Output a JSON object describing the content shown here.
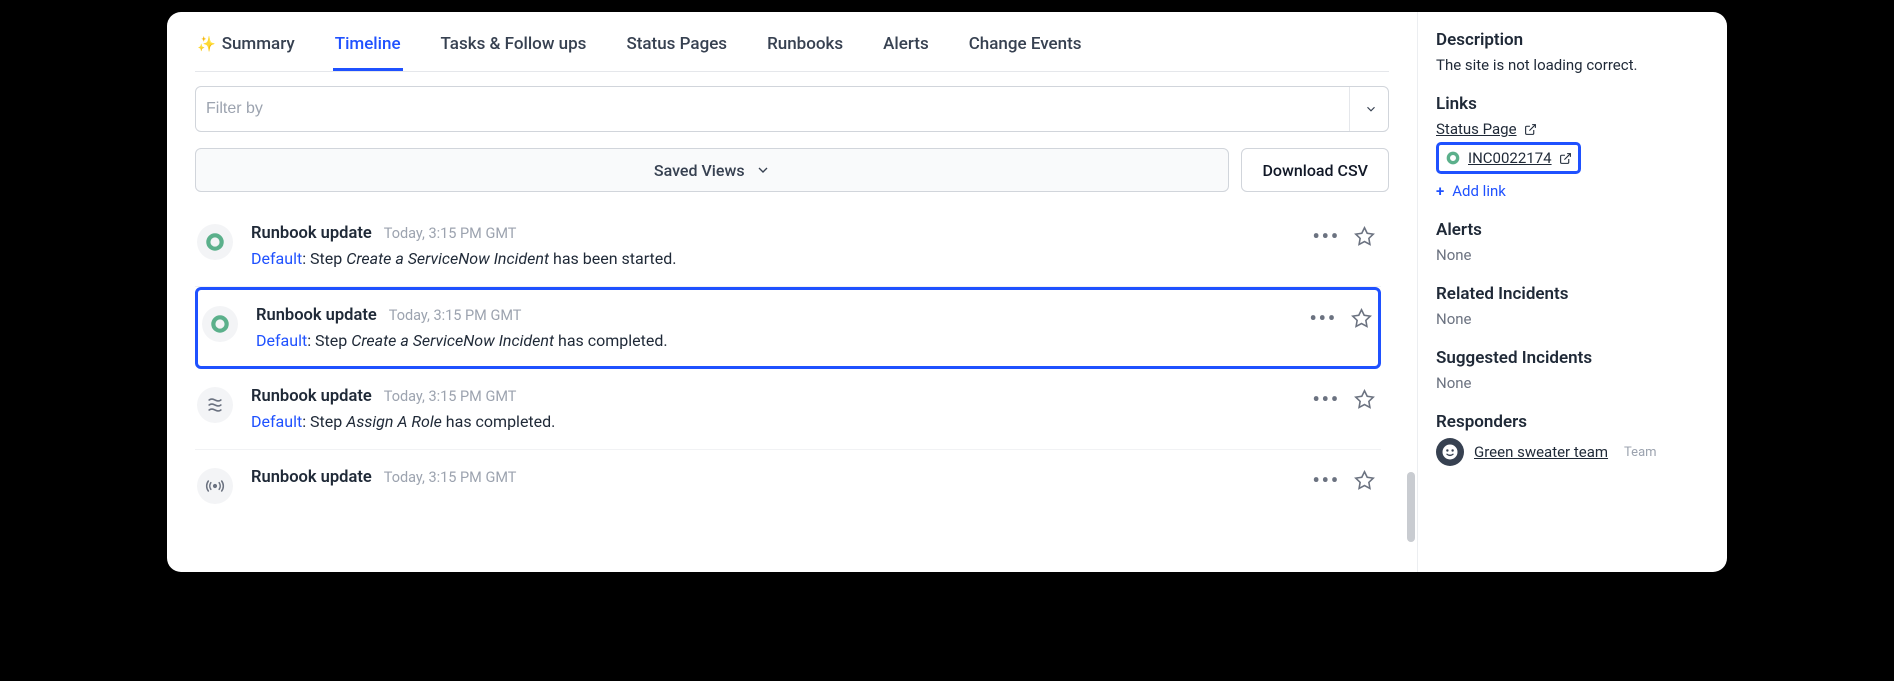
{
  "tabs": {
    "summary": "Summary",
    "timeline": "Timeline",
    "tasks": "Tasks & Follow ups",
    "status_pages": "Status Pages",
    "runbooks": "Runbooks",
    "alerts": "Alerts",
    "change_events": "Change Events"
  },
  "filter": {
    "placeholder": "Filter by"
  },
  "actions": {
    "saved_views": "Saved Views",
    "download_csv": "Download CSV"
  },
  "timeline": [
    {
      "title": "Runbook update",
      "ts": "Today, 3:15 PM GMT",
      "prefix": "Default",
      "lead": ": Step ",
      "step": "Create a ServiceNow Incident",
      "tail": " has been started.",
      "icon": "ring",
      "highlighted": false
    },
    {
      "title": "Runbook update",
      "ts": "Today, 3:15 PM GMT",
      "prefix": "Default",
      "lead": ": Step ",
      "step": "Create a ServiceNow Incident",
      "tail": " has completed.",
      "icon": "ring",
      "highlighted": true
    },
    {
      "title": "Runbook update",
      "ts": "Today, 3:15 PM GMT",
      "prefix": "Default",
      "lead": ": Step ",
      "step": "Assign A Role",
      "tail": " has completed.",
      "icon": "swirl",
      "highlighted": false
    },
    {
      "title": "Runbook update",
      "ts": "Today, 3:15 PM GMT",
      "prefix": "",
      "lead": "",
      "step": "",
      "tail": "",
      "icon": "antenna",
      "highlighted": false
    }
  ],
  "sidebar": {
    "description": {
      "heading": "Description",
      "text": "The site is not loading correct."
    },
    "links": {
      "heading": "Links",
      "items": [
        {
          "label": "Status Page",
          "highlighted": false,
          "show_ring": false
        },
        {
          "label": "INC0022174",
          "highlighted": true,
          "show_ring": true
        }
      ],
      "add": "Add link"
    },
    "alerts": {
      "heading": "Alerts",
      "value": "None"
    },
    "related": {
      "heading": "Related Incidents",
      "value": "None"
    },
    "suggested": {
      "heading": "Suggested Incidents",
      "value": "None"
    },
    "responders": {
      "heading": "Responders",
      "items": [
        {
          "name": "Green sweater team",
          "role": "Team"
        }
      ]
    }
  }
}
